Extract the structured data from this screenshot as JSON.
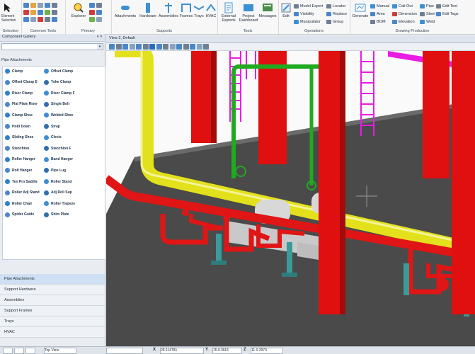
{
  "ribbon": {
    "selection": {
      "label": "Selection",
      "element_selection": "Element\nSelection"
    },
    "common_tools": {
      "label": "Common Tools"
    },
    "primary": {
      "label": "Primary",
      "explorer": "Explorer"
    },
    "supports": {
      "label": "Supports",
      "buttons": [
        "Attachments",
        "Hardware",
        "Assemblies",
        "Frames",
        "Trays",
        "HVAC"
      ]
    },
    "tools": {
      "label": "Tools",
      "buttons": [
        "External\nReports",
        "Project\nDashboard",
        "Messages"
      ]
    },
    "operations": {
      "label": "Operations",
      "edit": "Edit",
      "model_expert": "Model Expert",
      "visibility": "Visibility",
      "manipulator": "Manipulator",
      "locator": "Locator",
      "replace": "Replace",
      "group": "Group"
    },
    "drawing_production": {
      "label": "Drawing Production",
      "generate": "Generate",
      "manual": "Manual",
      "area": "Area",
      "bom": "BOM",
      "call_out": "Call Out",
      "dimension": "Dimension",
      "elevation": "Elevation",
      "pipe": "Pipe",
      "steel": "Steel",
      "weld": "Weld",
      "edit_text": "Edit Text",
      "edit_tags": "Edit Tags"
    }
  },
  "panel": {
    "title": "Component Gallery",
    "controls": "▾ ✕",
    "search_button": "▾",
    "section": "Pipe Attachments",
    "items": [
      "Clamp",
      "Offset Clamp",
      "Offset Clamp E",
      "Yoke Clamp",
      "Riser Clamp",
      "Riser Clamp F",
      "Flat Plate Riser",
      "Single Bolt",
      "Clamp Shoe",
      "Welded Shoe",
      "Hold Down",
      "Strap",
      "Sliding Shoe",
      "Clevis",
      "Stanchion",
      "Stanchion F",
      "Roller Hanger",
      "Band Hanger",
      "Rolt Hanger",
      "Pipe Lug",
      "Ten Pro Saddle",
      "Roller Stand",
      "Roller Adj Stand",
      "Adj Roll Sup",
      "Roller Chair",
      "Roller Trapeze",
      "Spider Guide",
      "Shim Plate"
    ],
    "lower": [
      "Pipe Attachments",
      "Support Hardware",
      "Assemblies",
      "Support Frames",
      "Trays",
      "HVAC"
    ]
  },
  "view": {
    "title": "View 2, Default"
  },
  "status": {
    "view_mode": "Top View",
    "x_label": "X",
    "x_value": "28.114781",
    "y_label": "Y",
    "y_value": "15.6.3661",
    "z_label": "Z",
    "z_value": "11.0.2973"
  },
  "colors": {
    "steel": "#e01010",
    "pipe_yellow": "#e3e11b",
    "pipe_green": "#1faa1f",
    "ladder_magenta": "#e81ce4",
    "pipe_red": "#e01515",
    "floor": "#4a4a4a",
    "equipment": "#c9c9c9",
    "support_teal": "#3b9a9a"
  }
}
